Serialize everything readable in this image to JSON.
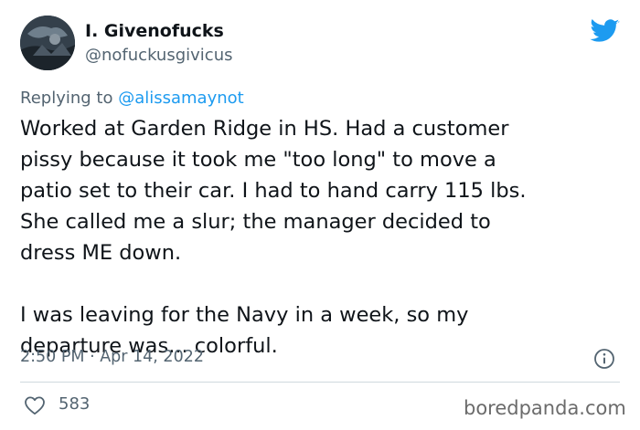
{
  "author": {
    "name": "I. Givenofucks",
    "handle": "@nofuckusgivicus"
  },
  "reply": {
    "prefix": "Replying to ",
    "mention": "@alissamaynot"
  },
  "body": {
    "paragraph_1": "Worked at Garden Ridge in HS.  Had a customer\npissy because it took me \"too long\" to move a\npatio set to their car.  I had to hand carry 115 lbs.\nShe called me a slur; the manager decided to\ndress ME down.",
    "paragraph_2": "I was leaving for the Navy in a week, so my\ndeparture was... colorful."
  },
  "meta": {
    "timestamp": "2:50 PM · Apr 14, 2022"
  },
  "actions": {
    "like_count": "583"
  },
  "watermark": "boredpanda.com",
  "colors": {
    "twitter_blue": "#1d9bf0",
    "text_primary": "#0f1419",
    "text_secondary": "#536471",
    "divider": "#cfd9de"
  },
  "icons": {
    "brand": "twitter-bird-icon",
    "info": "info-circle-icon",
    "like": "heart-outline-icon"
  }
}
